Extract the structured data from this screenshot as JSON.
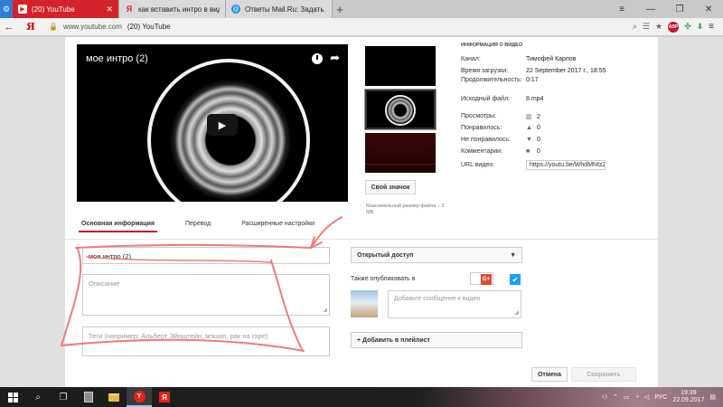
{
  "browser": {
    "tabs": [
      {
        "title": "(20) YouTube",
        "favicon": "youtube-icon",
        "active": true
      },
      {
        "title": "как вставить интро в видео",
        "favicon": "yandex-icon",
        "active": false
      },
      {
        "title": "Ответы Mail.Ru: Задать вопрос",
        "favicon": "mail-ru-icon",
        "active": false
      }
    ],
    "address": {
      "domain": "www.youtube.com",
      "page_title": "(20) YouTube"
    },
    "yandex_logo": "Я",
    "abp_label": "ABP"
  },
  "video": {
    "title": "мое интро (2)",
    "thumbnail_button": "Свой значок",
    "max_size_note": "Максимальный размер файла – 2 MB"
  },
  "info": {
    "header": "ИНФОРМАЦИЯ О ВИДЕО",
    "rows": [
      {
        "label": "Канал:",
        "value": "Тимофей Карпов"
      },
      {
        "label": "Время загрузки:",
        "value": "22 September 2017 г., 18:55"
      },
      {
        "label": "Продолжительность:",
        "value": "0:17"
      },
      {
        "label": "Исходный файл:",
        "value": "8.mp4"
      }
    ],
    "stats": [
      {
        "label": "Просмотры:",
        "value": "2",
        "icon": "bar-chart-icon"
      },
      {
        "label": "Понравилось:",
        "value": "0",
        "icon": "thumbs-up-icon"
      },
      {
        "label": "Не понравилось:",
        "value": "0",
        "icon": "thumbs-down-icon"
      },
      {
        "label": "Комментарии:",
        "value": "0",
        "icon": "comment-icon"
      }
    ],
    "url_label": "URL видео:",
    "url_value": "https://youtu.be/WhdMNtzZ_FU"
  },
  "edit_tabs": [
    "Основная информация",
    "Перевод",
    "Расширенные настройки"
  ],
  "form": {
    "title_value": "мое интро (2)",
    "description_placeholder": "Описание",
    "tags_placeholder": "Теги (например: Альберт Эйнштейн, мэшап, рак на горе)",
    "privacy_value": "Открытый доступ",
    "also_publish_label": "Также опубликовать в",
    "gplus_label": "G+",
    "compose_placeholder": "Добавьте сообщение к видео",
    "add_playlist": "+ Добавить в плейлист",
    "cancel": "Отмена",
    "save": "Сохранить"
  },
  "taskbar": {
    "language": "РУС",
    "time": "19:39",
    "date": "22.09.2017"
  }
}
